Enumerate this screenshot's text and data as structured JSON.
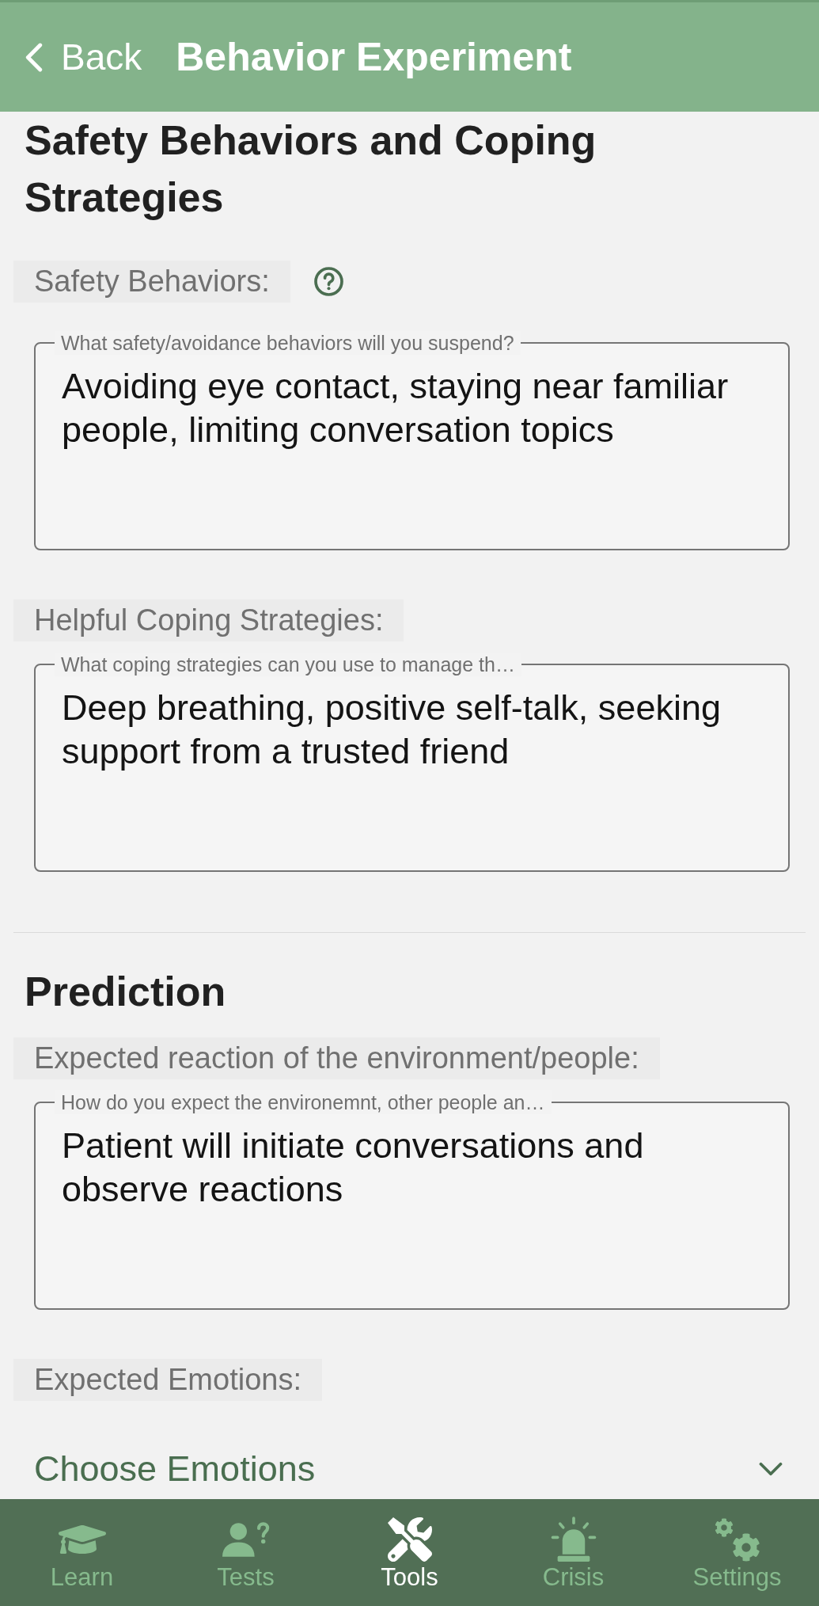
{
  "header": {
    "back_label": "Back",
    "title": "Behavior Experiment"
  },
  "sections": [
    {
      "title": "Safety Behaviors and Coping Strategies",
      "fields": [
        {
          "kind": "textarea",
          "label": "Safety Behaviors:",
          "help": true,
          "input_label": "What safety/avoidance behaviors will you suspend?",
          "value": "Avoiding eye contact, staying near familiar people, limiting conversation topics"
        },
        {
          "kind": "textarea",
          "label": "Helpful Coping Strategies:",
          "help": false,
          "input_label": "What coping strategies can you use to manage th…",
          "value": "Deep breathing, positive self-talk, seeking support from a trusted friend"
        }
      ]
    },
    {
      "title": "Prediction",
      "fields": [
        {
          "kind": "textarea",
          "label": "Expected reaction of the environment/people:",
          "help": false,
          "input_label": "How do you expect the environemnt, other people an…",
          "value": "Patient will initiate conversations and observe reactions"
        },
        {
          "kind": "dropdown",
          "label": "Expected Emotions:",
          "help": false,
          "placeholder": "Choose Emotions"
        }
      ]
    }
  ],
  "bottom_nav": [
    {
      "label": "Learn",
      "selected": false
    },
    {
      "label": "Tests",
      "selected": false
    },
    {
      "label": "Tools",
      "selected": true
    },
    {
      "label": "Crisis",
      "selected": false
    },
    {
      "label": "Settings",
      "selected": false
    }
  ]
}
